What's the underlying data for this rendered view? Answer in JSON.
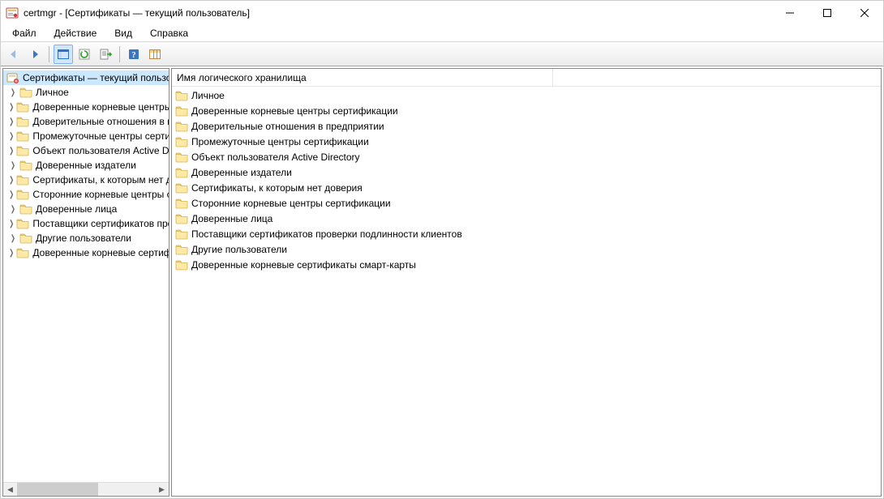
{
  "window": {
    "title": "certmgr - [Сертификаты — текущий пользователь]"
  },
  "menu": {
    "file": "Файл",
    "action": "Действие",
    "view": "Вид",
    "help": "Справка"
  },
  "tree": {
    "root": "Сертификаты — текущий пользователь",
    "items": [
      "Личное",
      "Доверенные корневые центры сертификации",
      "Доверительные отношения в предприятии",
      "Промежуточные центры сертификации",
      "Объект пользователя Active Directory",
      "Доверенные издатели",
      "Сертификаты, к которым нет доверия",
      "Сторонние корневые центры сертификации",
      "Доверенные лица",
      "Поставщики сертификатов проверки подлинности клиентов",
      "Другие пользователи",
      "Доверенные корневые сертификаты смарт-карты"
    ]
  },
  "list": {
    "column": "Имя логического хранилища",
    "items": [
      "Личное",
      "Доверенные корневые центры сертификации",
      "Доверительные отношения в предприятии",
      "Промежуточные центры сертификации",
      "Объект пользователя Active Directory",
      "Доверенные издатели",
      "Сертификаты, к которым нет доверия",
      "Сторонние корневые центры сертификации",
      "Доверенные лица",
      "Поставщики сертификатов проверки подлинности клиентов",
      "Другие пользователи",
      "Доверенные корневые сертификаты смарт-карты"
    ]
  }
}
